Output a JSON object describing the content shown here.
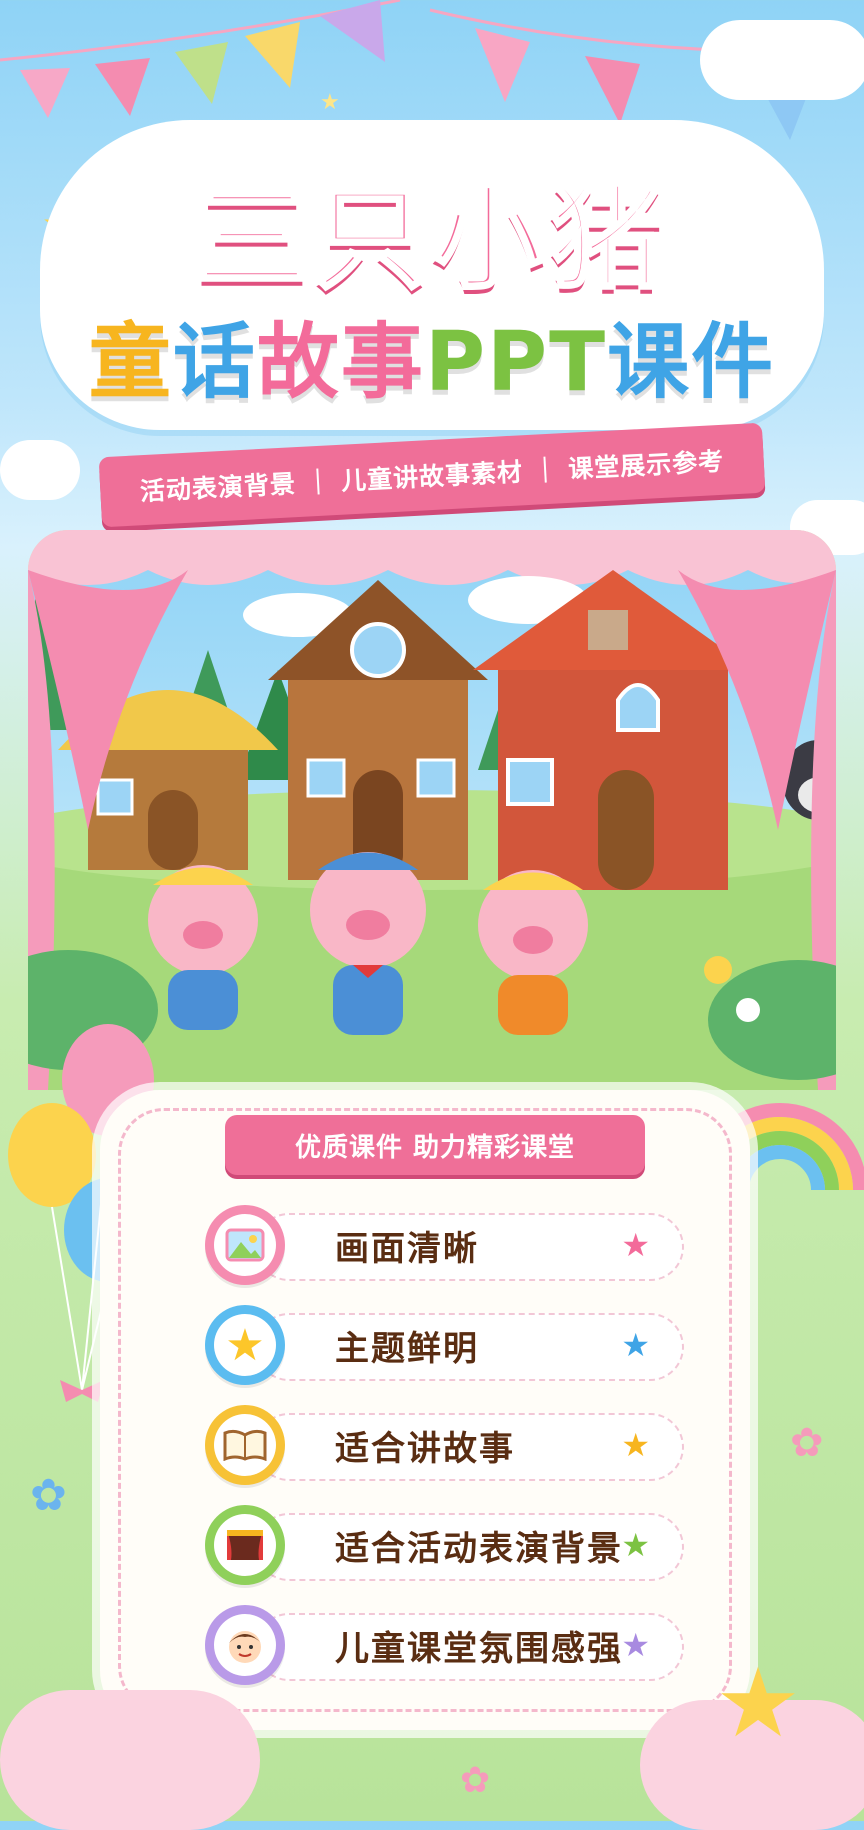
{
  "title": {
    "line1": "三只小猪",
    "line2_parts": [
      {
        "text": "童",
        "color": "#f7b51f"
      },
      {
        "text": "话",
        "color": "#3fa4e6"
      },
      {
        "text": "故",
        "color": "#f36b9a"
      },
      {
        "text": "事",
        "color": "#f36b9a"
      },
      {
        "text": "PPT",
        "color": "#7cc242"
      },
      {
        "text": "课",
        "color": "#3fa4e6"
      },
      {
        "text": "件",
        "color": "#3fa4e6"
      }
    ]
  },
  "ribbon": {
    "text": "活动表演背景 ｜ 儿童讲故事素材 ｜ 课堂展示参考"
  },
  "panel": {
    "heading": "优质课件  助力精彩课堂",
    "features": [
      {
        "label": "画面清晰",
        "icon": "picture-icon",
        "ring": "#f58cb0",
        "star_color": "#f36b9a"
      },
      {
        "label": "主题鲜明",
        "icon": "star-icon",
        "ring": "#5bbcf0",
        "star_color": "#3fa4e6"
      },
      {
        "label": "适合讲故事",
        "icon": "book-icon",
        "ring": "#f7c236",
        "star_color": "#f7b51f"
      },
      {
        "label": "适合活动表演背景",
        "icon": "stage-icon",
        "ring": "#8fd05a",
        "star_color": "#7cc242"
      },
      {
        "label": "儿童课堂氛围感强",
        "icon": "child-face-icon",
        "ring": "#b99ae8",
        "star_color": "#a88ae0"
      }
    ]
  },
  "colors": {
    "accent": "#ef6f98",
    "sky": "#8fd3f6",
    "grass": "#a6d97a"
  }
}
